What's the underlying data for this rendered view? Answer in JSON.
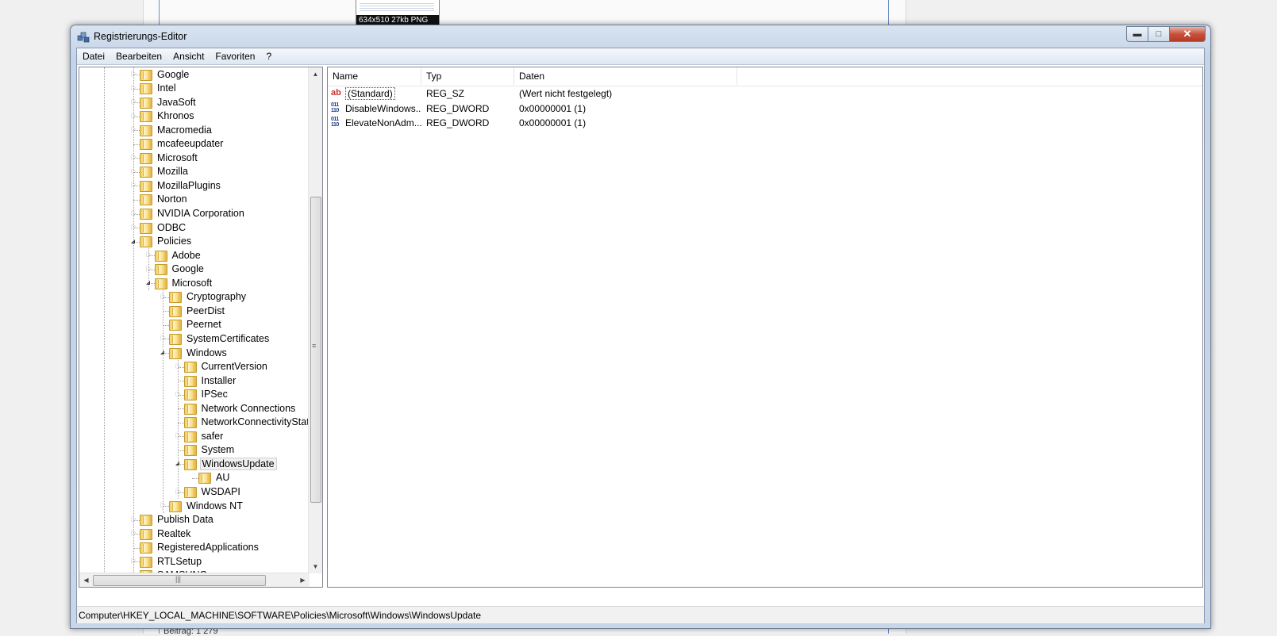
{
  "background": {
    "thumbnail_caption": "634x510 27kb PNG",
    "bottom_text": "Beitrag: 1 279"
  },
  "window": {
    "title": "Registrierungs-Editor",
    "minimize_icon": "minimize-icon",
    "maximize_icon": "maximize-icon",
    "close_icon": "close-icon"
  },
  "menu": [
    "Datei",
    "Bearbeiten",
    "Ansicht",
    "Favoriten",
    "?"
  ],
  "tree": [
    {
      "label": "Google",
      "depth": 0,
      "expander": "closed"
    },
    {
      "label": "Intel",
      "depth": 0,
      "expander": "closed"
    },
    {
      "label": "JavaSoft",
      "depth": 0,
      "expander": "closed"
    },
    {
      "label": "Khronos",
      "depth": 0,
      "expander": "closed"
    },
    {
      "label": "Macromedia",
      "depth": 0,
      "expander": "closed"
    },
    {
      "label": "mcafeeupdater",
      "depth": 0,
      "expander": "none"
    },
    {
      "label": "Microsoft",
      "depth": 0,
      "expander": "closed"
    },
    {
      "label": "Mozilla",
      "depth": 0,
      "expander": "closed"
    },
    {
      "label": "MozillaPlugins",
      "depth": 0,
      "expander": "closed"
    },
    {
      "label": "Norton",
      "depth": 0,
      "expander": "none"
    },
    {
      "label": "NVIDIA Corporation",
      "depth": 0,
      "expander": "closed"
    },
    {
      "label": "ODBC",
      "depth": 0,
      "expander": "closed"
    },
    {
      "label": "Policies",
      "depth": 0,
      "expander": "open"
    },
    {
      "label": "Adobe",
      "depth": 1,
      "expander": "closed"
    },
    {
      "label": "Google",
      "depth": 1,
      "expander": "closed"
    },
    {
      "label": "Microsoft",
      "depth": 1,
      "expander": "open"
    },
    {
      "label": "Cryptography",
      "depth": 2,
      "expander": "closed"
    },
    {
      "label": "PeerDist",
      "depth": 2,
      "expander": "none"
    },
    {
      "label": "Peernet",
      "depth": 2,
      "expander": "none"
    },
    {
      "label": "SystemCertificates",
      "depth": 2,
      "expander": "closed"
    },
    {
      "label": "Windows",
      "depth": 2,
      "expander": "open"
    },
    {
      "label": "CurrentVersion",
      "depth": 3,
      "expander": "closed"
    },
    {
      "label": "Installer",
      "depth": 3,
      "expander": "none"
    },
    {
      "label": "IPSec",
      "depth": 3,
      "expander": "closed"
    },
    {
      "label": "Network Connections",
      "depth": 3,
      "expander": "none"
    },
    {
      "label": "NetworkConnectivityStatusIndicator",
      "depth": 3,
      "expander": "none"
    },
    {
      "label": "safer",
      "depth": 3,
      "expander": "closed"
    },
    {
      "label": "System",
      "depth": 3,
      "expander": "none"
    },
    {
      "label": "WindowsUpdate",
      "depth": 3,
      "expander": "open",
      "selected": true
    },
    {
      "label": "AU",
      "depth": 4,
      "expander": "none"
    },
    {
      "label": "WSDAPI",
      "depth": 3,
      "expander": "closed"
    },
    {
      "label": "Windows NT",
      "depth": 2,
      "expander": "closed"
    },
    {
      "label": "Publish Data",
      "depth": 0,
      "expander": "closed"
    },
    {
      "label": "Realtek",
      "depth": 0,
      "expander": "closed"
    },
    {
      "label": "RegisteredApplications",
      "depth": 0,
      "expander": "none"
    },
    {
      "label": "RTLSetup",
      "depth": 0,
      "expander": "closed"
    },
    {
      "label": "SAMSUNG",
      "depth": 0,
      "expander": "closed"
    }
  ],
  "list": {
    "columns": [
      "Name",
      "Typ",
      "Daten"
    ],
    "rows": [
      {
        "icon": "string-value-icon",
        "name": "(Standard)",
        "type": "REG_SZ",
        "data": "(Wert nicht festgelegt)"
      },
      {
        "icon": "binary-value-icon",
        "name": "DisableWindows...",
        "type": "REG_DWORD",
        "data": "0x00000001 (1)"
      },
      {
        "icon": "binary-value-icon",
        "name": "ElevateNonAdm...",
        "type": "REG_DWORD",
        "data": "0x00000001 (1)"
      }
    ]
  },
  "status": {
    "path": "Computer\\HKEY_LOCAL_MACHINE\\SOFTWARE\\Policies\\Microsoft\\Windows\\WindowsUpdate"
  }
}
